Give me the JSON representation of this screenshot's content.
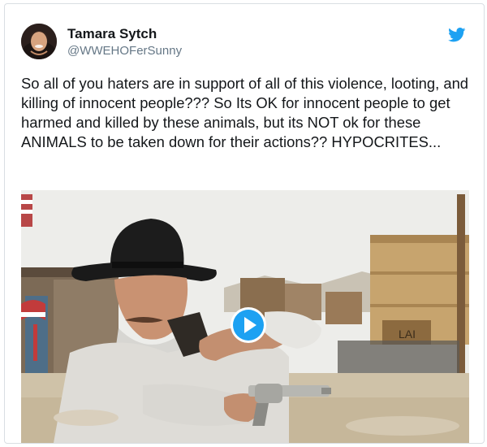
{
  "tweet": {
    "display_name": "Tamara Sytch",
    "handle": "@WWEHOFerSunny",
    "text": "So all of you haters are in support of all of this violence, looting, and killing of innocent people??? So Its OK for innocent people to get harmed and killed by these animals, but its NOT ok for these ANIMALS to be taken down for their actions?? HYPOCRITES...",
    "brand_color": "#1da1f2"
  },
  "media": {
    "type": "gif",
    "sign_text": "LAI",
    "icons": [
      "play-icon"
    ]
  }
}
